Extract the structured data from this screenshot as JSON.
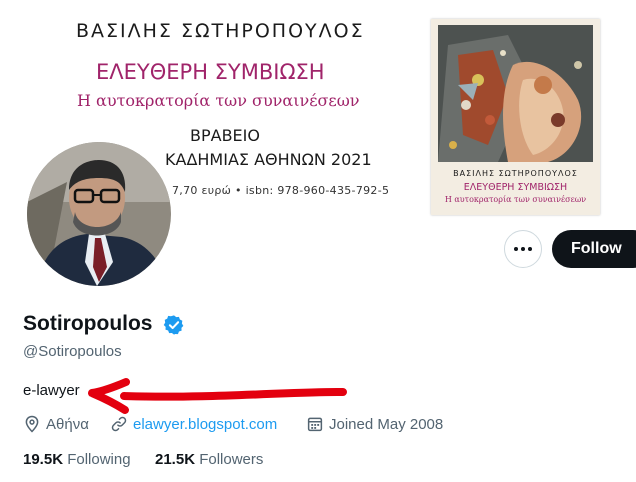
{
  "banner": {
    "author": "ΒΑΣΙΛΗΣ ΣΩΤΗΡΟΠΟΥΛΟΣ",
    "title": "ΕΛΕΥΘΕΡΗ ΣΥΜΒΙΩΣΗ",
    "subtitle": "Η αυτοκρατορία των συναινέσεων",
    "award_line1": "ΒΡΑΒΕΙΟ",
    "award_line2": "ΚΑΔΗΜΙΑΣ ΑΘΗΝΩΝ 2021",
    "price_isbn": "7,70 ευρώ • isbn: 978-960-435-792-5",
    "cover": {
      "author": "ΒΑΣΙΛΗΣ ΣΩΤΗΡΟΠΟΥΛΟΣ",
      "title": "ΕΛΕΥΘΕΡΗ ΣΥΜΒΙΩΣΗ",
      "subtitle": "Η αυτοκρατορία των συναινέσεων"
    }
  },
  "actions": {
    "follow_label": "Follow",
    "more_icon": "more-horizontal-icon"
  },
  "profile": {
    "name": "Sotiropoulos",
    "verified": true,
    "handle": "@Sotiropoulos",
    "bio": "e-lawyer",
    "location": "Αθήνα",
    "website": "elawyer.blogspot.com",
    "joined": "Joined May 2008",
    "following_count": "19.5K",
    "following_label": "Following",
    "followers_count": "21.5K",
    "followers_label": "Followers"
  },
  "colors": {
    "accent_blue": "#1d9bf0",
    "title_magenta": "#a0246a",
    "annotation_red": "#e3000f",
    "follow_bg": "#0f1419"
  }
}
